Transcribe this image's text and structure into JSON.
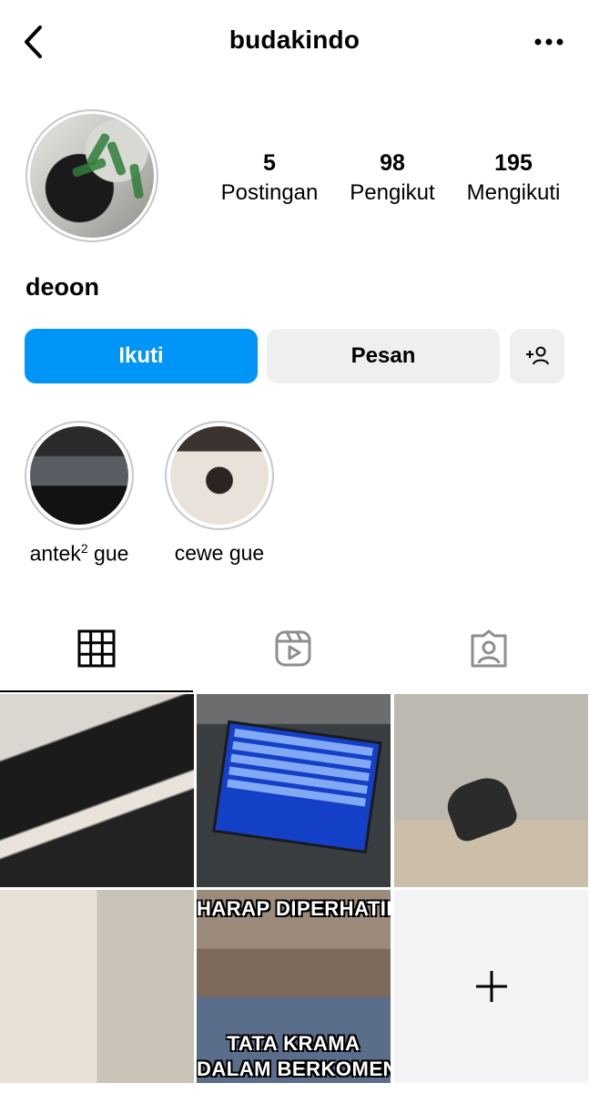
{
  "header": {
    "username": "budakindo",
    "back_icon": "chevron-left-icon",
    "more_icon": "more-horizontal-icon"
  },
  "profile": {
    "display_name": "deoon",
    "stats": [
      {
        "value": "5",
        "label": "Postingan"
      },
      {
        "value": "98",
        "label": "Pengikut"
      },
      {
        "value": "195",
        "label": "Mengikuti"
      }
    ]
  },
  "actions": {
    "follow_label": "Ikuti",
    "message_label": "Pesan",
    "add_user_icon": "add-user-icon"
  },
  "highlights": [
    {
      "label_main": "antek",
      "label_sup": "2",
      "label_rest": " gue"
    },
    {
      "label": "cewe gue"
    }
  ],
  "tabs": [
    {
      "icon": "grid-icon",
      "active": true
    },
    {
      "icon": "reels-icon",
      "active": false
    },
    {
      "icon": "tagged-icon",
      "active": false
    }
  ],
  "posts": {
    "meme_top": "HARAP DIPERHATIKAN",
    "meme_bottom_1": "TATA KRAMA",
    "meme_bottom_2": "DALAM BERKOMENTAR",
    "add_icon": "plus-icon"
  },
  "colors": {
    "follow_button": "#0095f6",
    "secondary_button": "#efefef"
  }
}
